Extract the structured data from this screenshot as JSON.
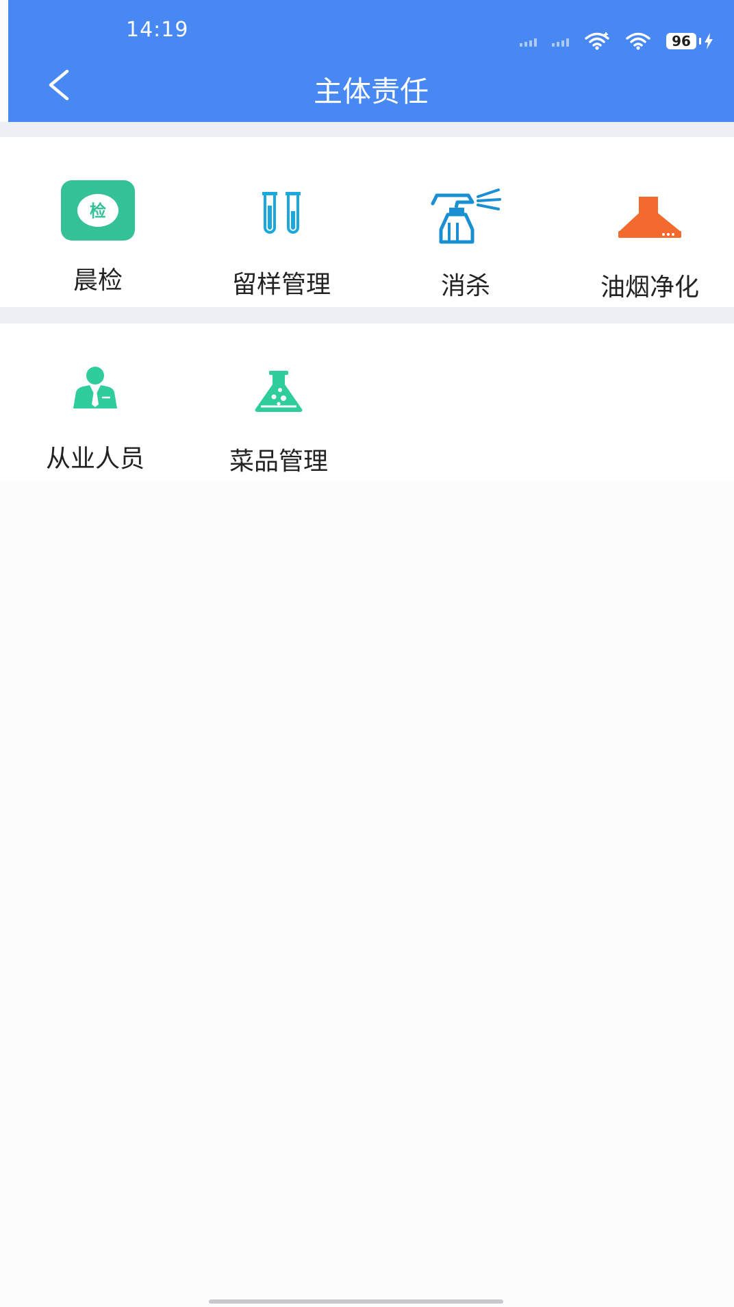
{
  "status_bar": {
    "time": "14:19",
    "battery": "96"
  },
  "nav": {
    "title": "主体责任"
  },
  "sections": [
    {
      "items": [
        {
          "label": "晨检",
          "icon": "check-badge-icon",
          "icon_text": "检",
          "color": "#35c197"
        },
        {
          "label": "留样管理",
          "icon": "test-tubes-icon",
          "color": "#1aa8df"
        },
        {
          "label": "消杀",
          "icon": "spray-bottle-icon",
          "color": "#1a8fd1"
        },
        {
          "label": "油烟净化",
          "icon": "range-hood-icon",
          "color": "#f26a2e"
        }
      ]
    },
    {
      "items": [
        {
          "label": "从业人员",
          "icon": "staff-person-icon",
          "color": "#2fcc9c"
        },
        {
          "label": "菜品管理",
          "icon": "lab-flask-icon",
          "color": "#2fcc9c"
        }
      ]
    }
  ],
  "colors": {
    "header_bg": "#4788f3",
    "divider": "#eeeff4",
    "page_bg": "#fcfcfd"
  }
}
